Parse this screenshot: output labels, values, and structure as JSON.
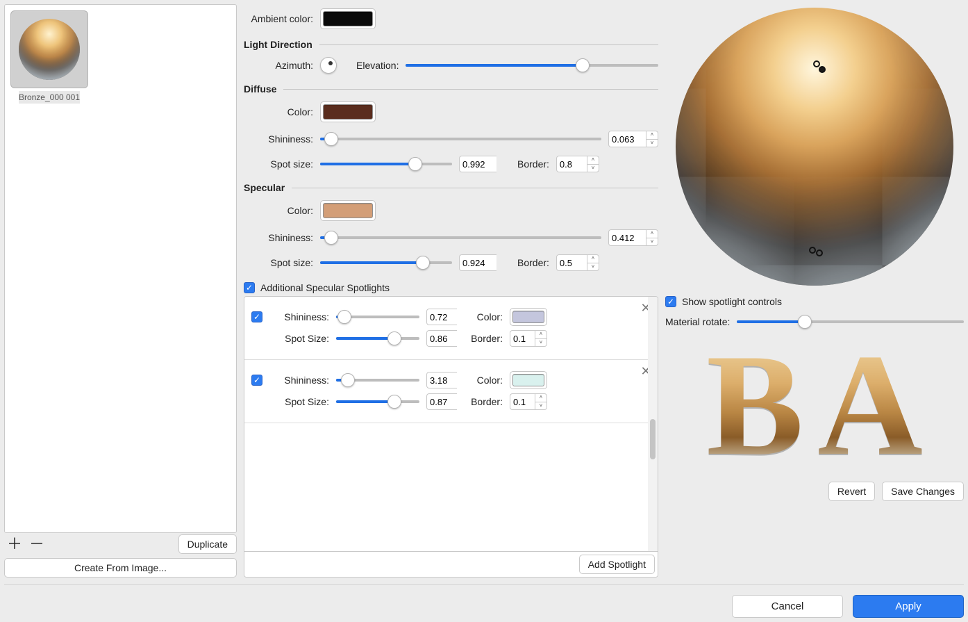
{
  "sidebar": {
    "item_label": "Bronze_000 001",
    "duplicate": "Duplicate",
    "create_from_image": "Create From Image..."
  },
  "ambient": {
    "label": "Ambient color:",
    "swatch": "#0b0b0b"
  },
  "light_direction": {
    "heading": "Light Direction",
    "azimuth_label": "Azimuth:",
    "elevation_label": "Elevation:",
    "elevation_pct": 70
  },
  "diffuse": {
    "heading": "Diffuse",
    "color_label": "Color:",
    "swatch": "#5a2d1e",
    "shininess_label": "Shininess:",
    "shininess_value": "0.063",
    "shininess_pct": 4,
    "spot_label": "Spot size:",
    "spot_value": "0.992",
    "spot_pct": 72,
    "border_label": "Border:",
    "border_value": "0.8"
  },
  "specular": {
    "heading": "Specular",
    "color_label": "Color:",
    "swatch": "#d39e77",
    "shininess_label": "Shininess:",
    "shininess_value": "0.412",
    "shininess_pct": 4,
    "spot_label": "Spot size:",
    "spot_value": "0.924",
    "spot_pct": 78,
    "border_label": "Border:",
    "border_value": "0.5"
  },
  "additional": {
    "checkbox_label": "Additional Specular Spotlights",
    "add_button": "Add Spotlight",
    "spots": [
      {
        "enabled": true,
        "shininess_label": "Shininess:",
        "shininess_value": "0.72",
        "shininess_pct": 10,
        "color_label": "Color:",
        "swatch": "#c4c6dd",
        "spot_label": "Spot Size:",
        "spot_value": "0.86",
        "spot_pct": 70,
        "border_label": "Border:",
        "border_value": "0.1"
      },
      {
        "enabled": true,
        "shininess_label": "Shininess:",
        "shininess_value": "3.18",
        "shininess_pct": 14,
        "color_label": "Color:",
        "swatch": "#d9f1ee",
        "spot_label": "Spot Size:",
        "spot_value": "0.87",
        "spot_pct": 70,
        "border_label": "Border:",
        "border_value": "0.1"
      }
    ]
  },
  "right": {
    "show_spotlight_label": "Show spotlight controls",
    "material_rotate_label": "Material rotate:",
    "material_rotate_pct": 30,
    "revert": "Revert",
    "save": "Save Changes"
  },
  "footer": {
    "cancel": "Cancel",
    "apply": "Apply"
  }
}
